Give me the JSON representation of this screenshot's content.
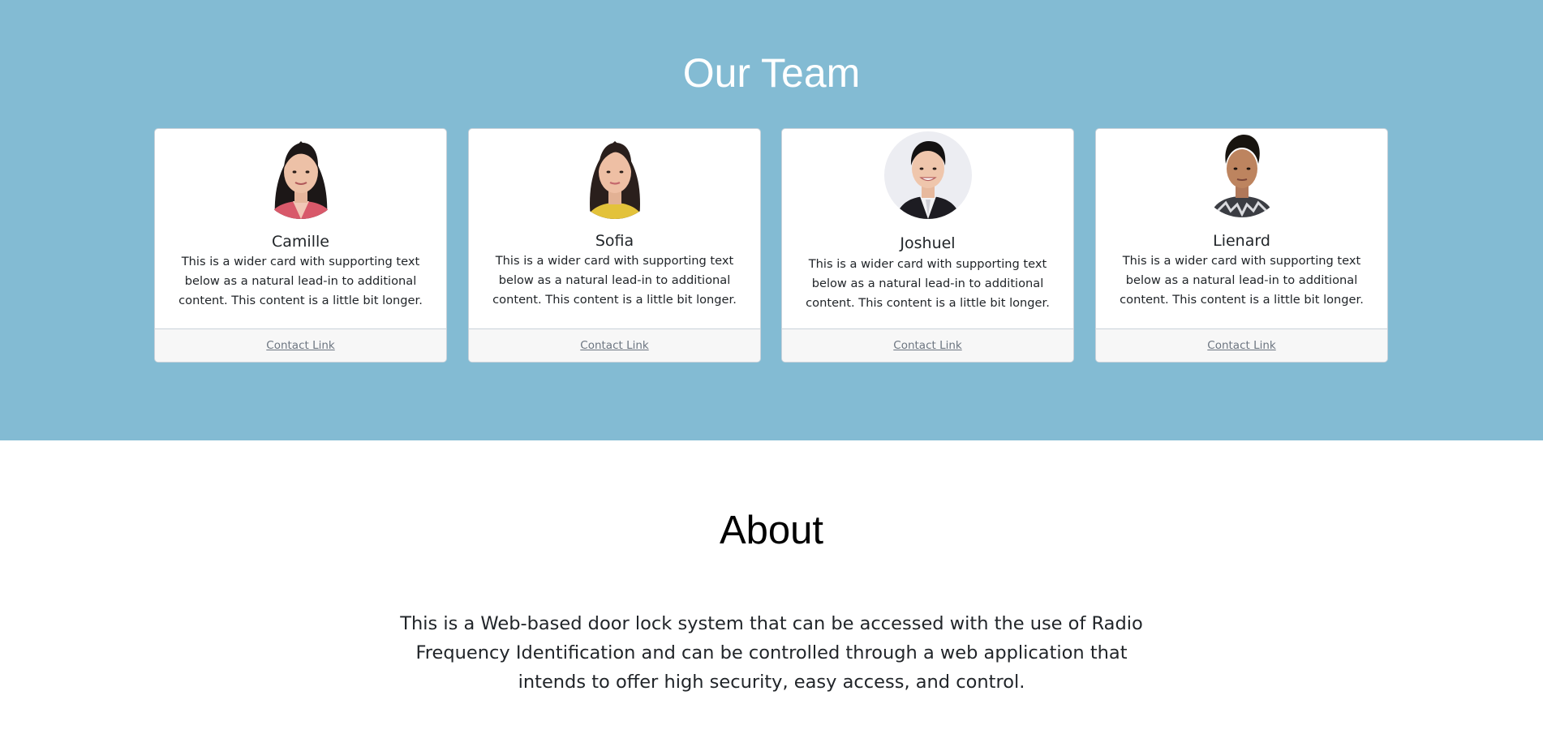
{
  "team": {
    "title": "Our Team",
    "members": [
      {
        "name": "Camille",
        "text": "This is a wider card with supporting text below as a natural lead-in to additional content. This content is a little bit longer.",
        "link": "Contact Link"
      },
      {
        "name": "Sofia",
        "text": "This is a wider card with supporting text below as a natural lead-in to additional content. This content is a little bit longer.",
        "link": "Contact Link"
      },
      {
        "name": "Joshuel",
        "text": "This is a wider card with supporting text below as a natural lead-in to additional content. This content is a little bit longer.",
        "link": "Contact Link"
      },
      {
        "name": "Lienard",
        "text": "This is a wider card with supporting text below as a natural lead-in to additional content. This content is a little bit longer.",
        "link": "Contact Link"
      }
    ]
  },
  "about": {
    "title": "About",
    "text": "This is a Web-based door lock system that can be accessed with the use of Radio Frequency Identification and can be controlled through a web application that intends to offer high security, easy access, and control."
  },
  "colors": {
    "team_background": "#83bbd3",
    "card_footer": "#f7f7f7",
    "link": "#6c7580"
  }
}
